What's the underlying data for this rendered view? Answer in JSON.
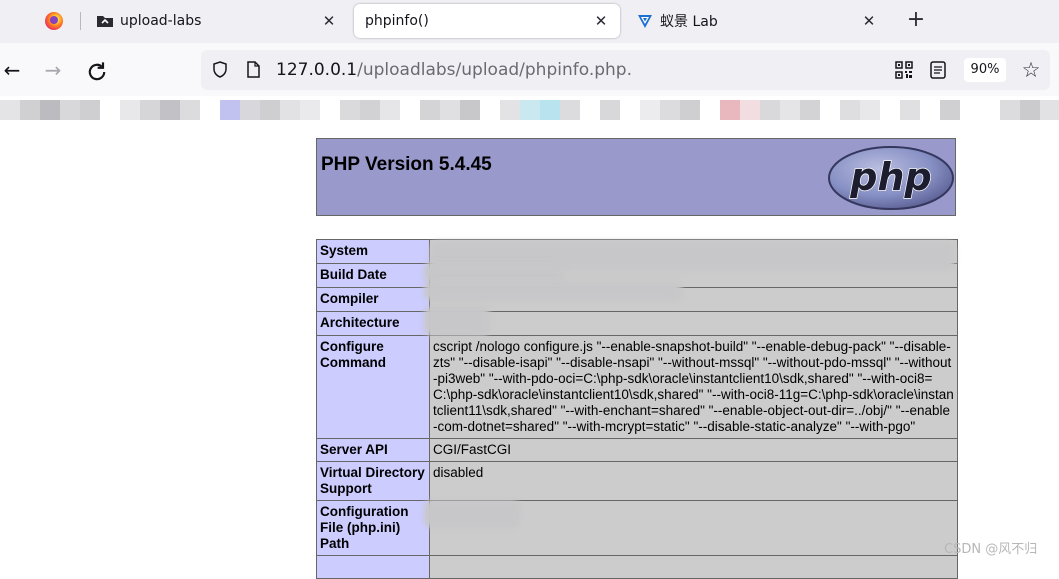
{
  "tabs": [
    {
      "label": "upload-labs",
      "icon": "folder-icon"
    },
    {
      "label": "phpinfo()",
      "active": true
    },
    {
      "label": "蚁景 Lab",
      "icon": "antlab-icon"
    }
  ],
  "nav": {
    "url_host": "127.0.0.1",
    "url_path": "/uploadlabs/upload/phpinfo.php.",
    "zoom": "90%"
  },
  "phpinfo": {
    "version": "PHP Version 5.4.45",
    "logo_text": "php",
    "rows": [
      {
        "label": "System",
        "value": ""
      },
      {
        "label": "Build Date",
        "value": ""
      },
      {
        "label": "Compiler",
        "value": ""
      },
      {
        "label": "Architecture",
        "value": ""
      },
      {
        "label": "Configure Command",
        "value": "cscript /nologo configure.js \"--enable-snapshot-build\" \"--enable-debug-pack\" \"--disable-zts\" \"--disable-isapi\" \"--disable-nsapi\" \"--without-mssql\" \"--without-pdo-mssql\" \"--without-pi3web\" \"--with-pdo-oci=C:\\php-sdk\\oracle\\instantclient10\\sdk,shared\" \"--with-oci8=C:\\php-sdk\\oracle\\instantclient10\\sdk,shared\" \"--with-oci8-11g=C:\\php-sdk\\oracle\\instantclient11\\sdk,shared\" \"--with-enchant=shared\" \"--enable-object-out-dir=../obj/\" \"--enable-com-dotnet=shared\" \"--with-mcrypt=static\" \"--disable-static-analyze\" \"--with-pgo\""
      },
      {
        "label": "Server API",
        "value": "CGI/FastCGI"
      },
      {
        "label": "Virtual Directory Support",
        "value": "disabled"
      },
      {
        "label": "Configuration File (php.ini) Path",
        "value": ""
      }
    ]
  },
  "watermark": "CSDN @风不归"
}
